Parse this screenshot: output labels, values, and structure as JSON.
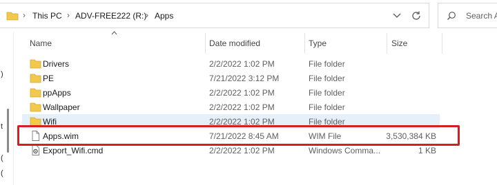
{
  "address_bar": {
    "breadcrumbs": [
      "This PC",
      "ADV-FREE222 (R:)",
      "Apps"
    ],
    "separator": ">"
  },
  "search": {
    "placeholder": "Search A"
  },
  "columns": {
    "name": "Name",
    "date_modified": "Date modified",
    "type": "Type",
    "size": "Size"
  },
  "files": [
    {
      "name": "Drivers",
      "date": "2/2/2022 1:02 PM",
      "type": "File folder",
      "size": "",
      "icon": "folder-icon"
    },
    {
      "name": "PE",
      "date": "7/21/2022 3:12 PM",
      "type": "File folder",
      "size": "",
      "icon": "folder-icon"
    },
    {
      "name": "ppApps",
      "date": "2/2/2022 1:02 PM",
      "type": "File folder",
      "size": "",
      "icon": "folder-icon"
    },
    {
      "name": "Wallpaper",
      "date": "2/2/2022 1:02 PM",
      "type": "File folder",
      "size": "",
      "icon": "folder-icon"
    },
    {
      "name": "Wifi",
      "date": "2/2/2022 1:02 PM",
      "type": "File folder",
      "size": "",
      "icon": "folder-icon",
      "selected": true
    },
    {
      "name": "Apps.wim",
      "date": "7/21/2022 8:45 AM",
      "type": "WIM File",
      "size": "3,530,384 KB",
      "icon": "file-icon",
      "highlighted": true
    },
    {
      "name": "Export_Wifi.cmd",
      "date": "2/2/2022 1:02 PM",
      "type": "Windows Comma...",
      "size": "1 KB",
      "icon": "script-file-icon"
    }
  ],
  "left_nav_glyphs": [
    ")",
    "t",
    "(",
    "("
  ],
  "colors": {
    "folder": "#f2c94c",
    "selection": "#e5f0fb",
    "highlight_border": "#d21f1f"
  }
}
